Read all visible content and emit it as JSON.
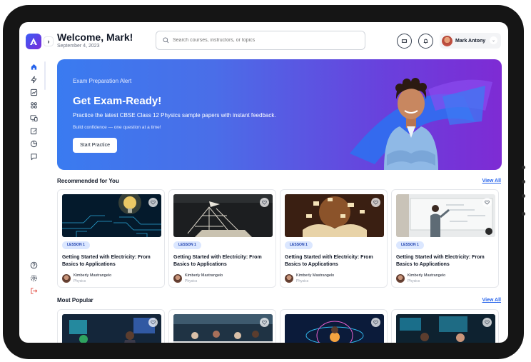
{
  "header": {
    "welcome": "Welcome, Mark!",
    "date": "September 4,  2023",
    "search_placeholder": "Search courses, instructors, or topics",
    "profile_name": "Mark Antony"
  },
  "banner": {
    "eyebrow": "Exam Preparation Alert",
    "title": "Get Exam-Ready!",
    "description": "Practice the latest CBSE Class 12 Physics sample papers with instant feedback.",
    "subtext": "Build confidence — one question at a time!",
    "button_label": "Start Practice"
  },
  "recommended": {
    "title": "Recommended for You",
    "view_all": "View All",
    "cards": [
      {
        "badge": "LESSON 1",
        "title": "Getting Started with Electricity: From Basics to Applications",
        "author": "Kimberly Mastrangelo",
        "subject": "Physics"
      },
      {
        "badge": "LESSON 1",
        "title": "Getting Started with Electricity: From Basics to Applications",
        "author": "Kimberly Mastrangelo",
        "subject": "Physics"
      },
      {
        "badge": "LESSON 1",
        "title": "Getting Started with Electricity: From Basics to Applications",
        "author": "Kimberly Mastrangelo",
        "subject": "Physics"
      },
      {
        "badge": "LESSON 1",
        "title": "Getting Started with Electricity: From Basics to Applications",
        "author": "Kimberly Mastrangelo",
        "subject": "Physics"
      }
    ]
  },
  "popular": {
    "title": "Most Popular",
    "view_all": "View All"
  },
  "sidebar": {
    "icons": [
      "home-icon",
      "bolt-icon",
      "chart-icon",
      "grid-icon",
      "devices-icon",
      "edit-icon",
      "pie-chart-icon",
      "chat-icon",
      "help-icon",
      "settings-icon",
      "logout-icon"
    ]
  },
  "colors": {
    "accent": "#2563eb",
    "banner_start": "#3a7bf0",
    "banner_end": "#7e2bd4",
    "logout": "#e0453a"
  }
}
